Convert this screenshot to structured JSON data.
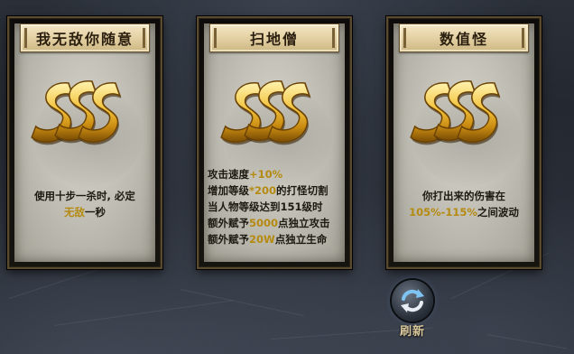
{
  "cards": [
    {
      "title": "我无敌你随意",
      "rank": "SSS",
      "desc_lines": [
        [
          {
            "t": "使用十步一杀时, 必定"
          }
        ],
        [
          {
            "t": "无敌",
            "hl": true
          },
          {
            "t": "一秒"
          }
        ]
      ]
    },
    {
      "title": "扫地僧",
      "rank": "SSS",
      "desc_lines": [
        [
          {
            "t": "攻击速度"
          },
          {
            "t": "+10%",
            "hl": true
          }
        ],
        [
          {
            "t": "增加等级"
          },
          {
            "t": "*200",
            "hl": true
          },
          {
            "t": "的打怪切割"
          }
        ],
        [
          {
            "t": "当人物等级达到151级时"
          }
        ],
        [
          {
            "t": "额外赋予"
          },
          {
            "t": "5000",
            "hl": true
          },
          {
            "t": "点独立攻击"
          }
        ],
        [
          {
            "t": "额外赋予"
          },
          {
            "t": "20W",
            "hl": true
          },
          {
            "t": "点独立生命"
          }
        ]
      ]
    },
    {
      "title": "数值怪",
      "rank": "SSS",
      "desc_lines": [
        [
          {
            "t": "你打出来的伤害在"
          }
        ],
        [
          {
            "t": "105%-115%",
            "hl": true
          },
          {
            "t": "之间波动"
          }
        ]
      ]
    }
  ],
  "refresh": {
    "label": "刷新",
    "icon": "refresh-icon"
  },
  "colors": {
    "highlight": "#b58a10",
    "gold": "#e8b531",
    "title_text": "#2b1f10"
  }
}
